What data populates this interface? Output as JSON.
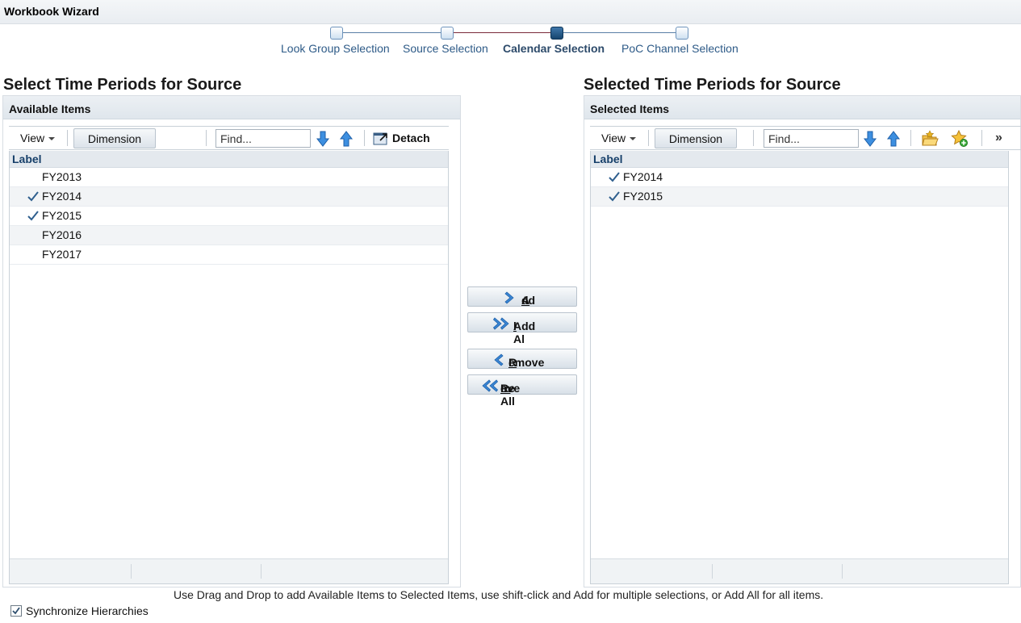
{
  "window": {
    "title": "Workbook Wizard"
  },
  "train": {
    "steps": [
      {
        "label": "Look Group Selection",
        "current": false
      },
      {
        "label": "Source Selection",
        "current": false
      },
      {
        "label": "Calendar Selection",
        "current": true
      },
      {
        "label": "PoC Channel Selection",
        "current": false
      }
    ]
  },
  "left": {
    "section_title": "Select Time Periods for Source",
    "panel_title": "Available Items",
    "toolbar": {
      "view_label": "View",
      "dimension_label": "Dimension",
      "find_placeholder": "Find...",
      "detach_label": "Detach"
    },
    "column_header": "Label",
    "rows": [
      {
        "label": "FY2013",
        "checked": false
      },
      {
        "label": "FY2014",
        "checked": true
      },
      {
        "label": "FY2015",
        "checked": true
      },
      {
        "label": "FY2016",
        "checked": false
      },
      {
        "label": "FY2017",
        "checked": false
      }
    ]
  },
  "right": {
    "section_title": "Selected Time Periods for Source",
    "panel_title": "Selected Items",
    "toolbar": {
      "view_label": "View",
      "dimension_label": "Dimension",
      "find_placeholder": "Find...",
      "more_label": "»"
    },
    "column_header": "Label",
    "rows": [
      {
        "label": "FY2014",
        "checked": true
      },
      {
        "label": "FY2015",
        "checked": true
      }
    ]
  },
  "shuttle": {
    "add": {
      "mnemonic": "A",
      "rest": "dd"
    },
    "add_all": {
      "before": "Add Al",
      "mnemonic": "l",
      "after": ""
    },
    "remove": {
      "mnemonic": "R",
      "rest": "emove"
    },
    "remove_all": {
      "before": "Re",
      "mnemonic": "m",
      "after": "ove All"
    }
  },
  "hint": "Use Drag and Drop to add Available Items to Selected Items, use shift-click and Add for multiple selections, or Add All for all items.",
  "sync": {
    "label": "Synchronize Hierarchies",
    "checked": true
  },
  "colors": {
    "accent": "#2d5a87",
    "check": "#2f5f8e",
    "header_bg": "#e4e9ee"
  }
}
